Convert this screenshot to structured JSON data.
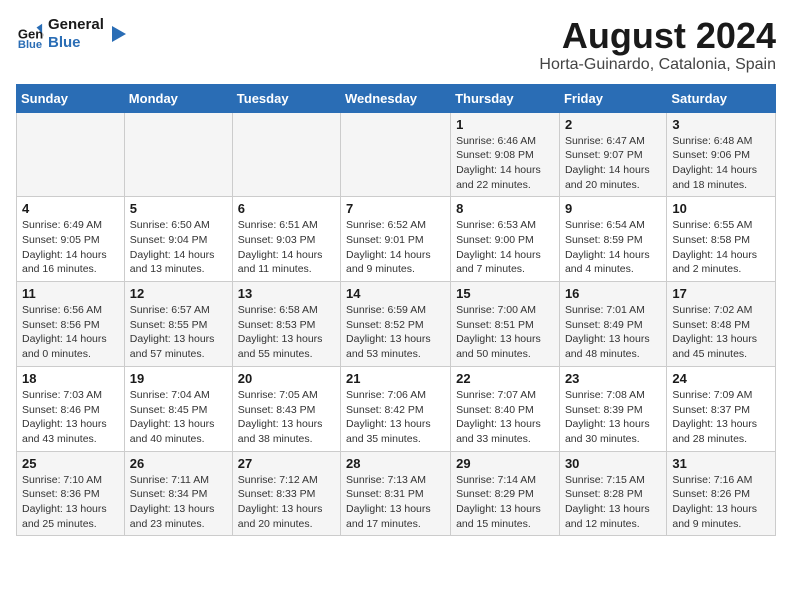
{
  "header": {
    "logo_line1": "General",
    "logo_line2": "Blue",
    "title": "August 2024",
    "subtitle": "Horta-Guinardo, Catalonia, Spain"
  },
  "weekdays": [
    "Sunday",
    "Monday",
    "Tuesday",
    "Wednesday",
    "Thursday",
    "Friday",
    "Saturday"
  ],
  "weeks": [
    [
      {
        "day": "",
        "info": ""
      },
      {
        "day": "",
        "info": ""
      },
      {
        "day": "",
        "info": ""
      },
      {
        "day": "",
        "info": ""
      },
      {
        "day": "1",
        "info": "Sunrise: 6:46 AM\nSunset: 9:08 PM\nDaylight: 14 hours\nand 22 minutes."
      },
      {
        "day": "2",
        "info": "Sunrise: 6:47 AM\nSunset: 9:07 PM\nDaylight: 14 hours\nand 20 minutes."
      },
      {
        "day": "3",
        "info": "Sunrise: 6:48 AM\nSunset: 9:06 PM\nDaylight: 14 hours\nand 18 minutes."
      }
    ],
    [
      {
        "day": "4",
        "info": "Sunrise: 6:49 AM\nSunset: 9:05 PM\nDaylight: 14 hours\nand 16 minutes."
      },
      {
        "day": "5",
        "info": "Sunrise: 6:50 AM\nSunset: 9:04 PM\nDaylight: 14 hours\nand 13 minutes."
      },
      {
        "day": "6",
        "info": "Sunrise: 6:51 AM\nSunset: 9:03 PM\nDaylight: 14 hours\nand 11 minutes."
      },
      {
        "day": "7",
        "info": "Sunrise: 6:52 AM\nSunset: 9:01 PM\nDaylight: 14 hours\nand 9 minutes."
      },
      {
        "day": "8",
        "info": "Sunrise: 6:53 AM\nSunset: 9:00 PM\nDaylight: 14 hours\nand 7 minutes."
      },
      {
        "day": "9",
        "info": "Sunrise: 6:54 AM\nSunset: 8:59 PM\nDaylight: 14 hours\nand 4 minutes."
      },
      {
        "day": "10",
        "info": "Sunrise: 6:55 AM\nSunset: 8:58 PM\nDaylight: 14 hours\nand 2 minutes."
      }
    ],
    [
      {
        "day": "11",
        "info": "Sunrise: 6:56 AM\nSunset: 8:56 PM\nDaylight: 14 hours\nand 0 minutes."
      },
      {
        "day": "12",
        "info": "Sunrise: 6:57 AM\nSunset: 8:55 PM\nDaylight: 13 hours\nand 57 minutes."
      },
      {
        "day": "13",
        "info": "Sunrise: 6:58 AM\nSunset: 8:53 PM\nDaylight: 13 hours\nand 55 minutes."
      },
      {
        "day": "14",
        "info": "Sunrise: 6:59 AM\nSunset: 8:52 PM\nDaylight: 13 hours\nand 53 minutes."
      },
      {
        "day": "15",
        "info": "Sunrise: 7:00 AM\nSunset: 8:51 PM\nDaylight: 13 hours\nand 50 minutes."
      },
      {
        "day": "16",
        "info": "Sunrise: 7:01 AM\nSunset: 8:49 PM\nDaylight: 13 hours\nand 48 minutes."
      },
      {
        "day": "17",
        "info": "Sunrise: 7:02 AM\nSunset: 8:48 PM\nDaylight: 13 hours\nand 45 minutes."
      }
    ],
    [
      {
        "day": "18",
        "info": "Sunrise: 7:03 AM\nSunset: 8:46 PM\nDaylight: 13 hours\nand 43 minutes."
      },
      {
        "day": "19",
        "info": "Sunrise: 7:04 AM\nSunset: 8:45 PM\nDaylight: 13 hours\nand 40 minutes."
      },
      {
        "day": "20",
        "info": "Sunrise: 7:05 AM\nSunset: 8:43 PM\nDaylight: 13 hours\nand 38 minutes."
      },
      {
        "day": "21",
        "info": "Sunrise: 7:06 AM\nSunset: 8:42 PM\nDaylight: 13 hours\nand 35 minutes."
      },
      {
        "day": "22",
        "info": "Sunrise: 7:07 AM\nSunset: 8:40 PM\nDaylight: 13 hours\nand 33 minutes."
      },
      {
        "day": "23",
        "info": "Sunrise: 7:08 AM\nSunset: 8:39 PM\nDaylight: 13 hours\nand 30 minutes."
      },
      {
        "day": "24",
        "info": "Sunrise: 7:09 AM\nSunset: 8:37 PM\nDaylight: 13 hours\nand 28 minutes."
      }
    ],
    [
      {
        "day": "25",
        "info": "Sunrise: 7:10 AM\nSunset: 8:36 PM\nDaylight: 13 hours\nand 25 minutes."
      },
      {
        "day": "26",
        "info": "Sunrise: 7:11 AM\nSunset: 8:34 PM\nDaylight: 13 hours\nand 23 minutes."
      },
      {
        "day": "27",
        "info": "Sunrise: 7:12 AM\nSunset: 8:33 PM\nDaylight: 13 hours\nand 20 minutes."
      },
      {
        "day": "28",
        "info": "Sunrise: 7:13 AM\nSunset: 8:31 PM\nDaylight: 13 hours\nand 17 minutes."
      },
      {
        "day": "29",
        "info": "Sunrise: 7:14 AM\nSunset: 8:29 PM\nDaylight: 13 hours\nand 15 minutes."
      },
      {
        "day": "30",
        "info": "Sunrise: 7:15 AM\nSunset: 8:28 PM\nDaylight: 13 hours\nand 12 minutes."
      },
      {
        "day": "31",
        "info": "Sunrise: 7:16 AM\nSunset: 8:26 PM\nDaylight: 13 hours\nand 9 minutes."
      }
    ]
  ]
}
